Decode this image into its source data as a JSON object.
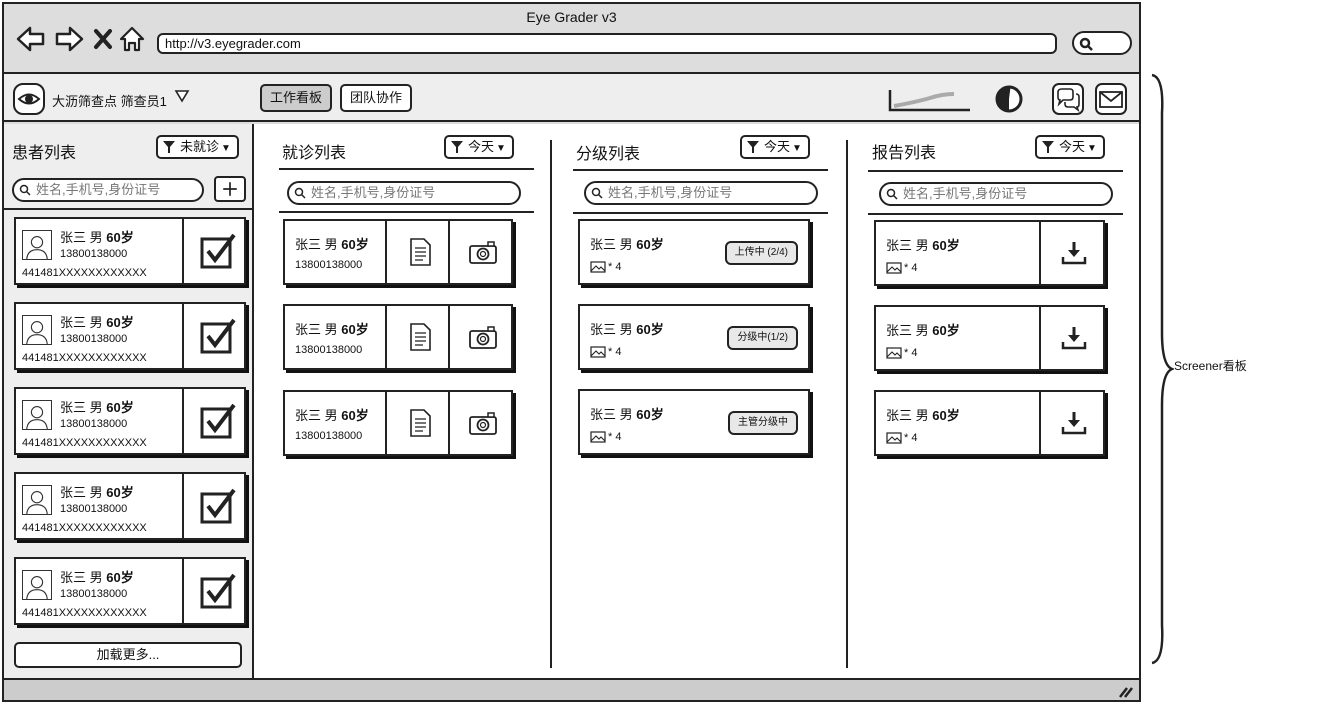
{
  "window": {
    "title": "Eye Grader v3",
    "url": "http://v3.eyegrader.com"
  },
  "toolbar": {
    "site_label": "大沥筛查点 筛查员1",
    "tabs": [
      {
        "label": "工作看板",
        "active": true
      },
      {
        "label": "团队协作",
        "active": false
      }
    ],
    "icons": [
      "eye-icon",
      "chevron-down-icon",
      "sparkline-chart-icon",
      "contrast-icon",
      "chat-icon",
      "mail-icon"
    ]
  },
  "patients": {
    "title": "患者列表",
    "filter_label": "未就诊",
    "search_placeholder": "姓名,手机号,身份证号",
    "load_more_label": "加载更多...",
    "items": [
      {
        "name": "张三 男 ",
        "age": "60岁",
        "phone": "13800138000",
        "id_number": "441481XXXXXXXXXXXX",
        "checked": true
      },
      {
        "name": "张三 男 ",
        "age": "60岁",
        "phone": "13800138000",
        "id_number": "441481XXXXXXXXXXXX",
        "checked": true
      },
      {
        "name": "张三 男 ",
        "age": "60岁",
        "phone": "13800138000",
        "id_number": "441481XXXXXXXXXXXX",
        "checked": true
      },
      {
        "name": "张三 男 ",
        "age": "60岁",
        "phone": "13800138000",
        "id_number": "441481XXXXXXXXXXXX",
        "checked": true
      },
      {
        "name": "张三 男 ",
        "age": "60岁",
        "phone": "13800138000",
        "id_number": "441481XXXXXXXXXXXX",
        "checked": true
      }
    ]
  },
  "visits": {
    "title": "就诊列表",
    "filter_label": "今天",
    "search_placeholder": "姓名,手机号,身份证号",
    "items": [
      {
        "name": "张三 男 ",
        "age": "60岁",
        "phone": "13800138000"
      },
      {
        "name": "张三 男 ",
        "age": "60岁",
        "phone": "13800138000"
      },
      {
        "name": "张三 男 ",
        "age": "60岁",
        "phone": "13800138000"
      }
    ]
  },
  "grading": {
    "title": "分级列表",
    "filter_label": "今天",
    "search_placeholder": "姓名,手机号,身份证号",
    "items": [
      {
        "name": "张三 男 ",
        "age": "60岁",
        "image_count": "* 4",
        "status": "上传中 (2/4)"
      },
      {
        "name": "张三 男 ",
        "age": "60岁",
        "image_count": "* 4",
        "status": "分级中(1/2)"
      },
      {
        "name": "张三 男 ",
        "age": "60岁",
        "image_count": "* 4",
        "status": "主管分级中"
      }
    ]
  },
  "reports": {
    "title": "报告列表",
    "filter_label": "今天",
    "search_placeholder": "姓名,手机号,身份证号",
    "items": [
      {
        "name": "张三 男 ",
        "age": "60岁",
        "image_count": "* 4"
      },
      {
        "name": "张三 男 ",
        "age": "60岁",
        "image_count": "* 4"
      },
      {
        "name": "张三 男 ",
        "age": "60岁",
        "image_count": "* 4"
      }
    ]
  },
  "annotation": "Screener看板"
}
